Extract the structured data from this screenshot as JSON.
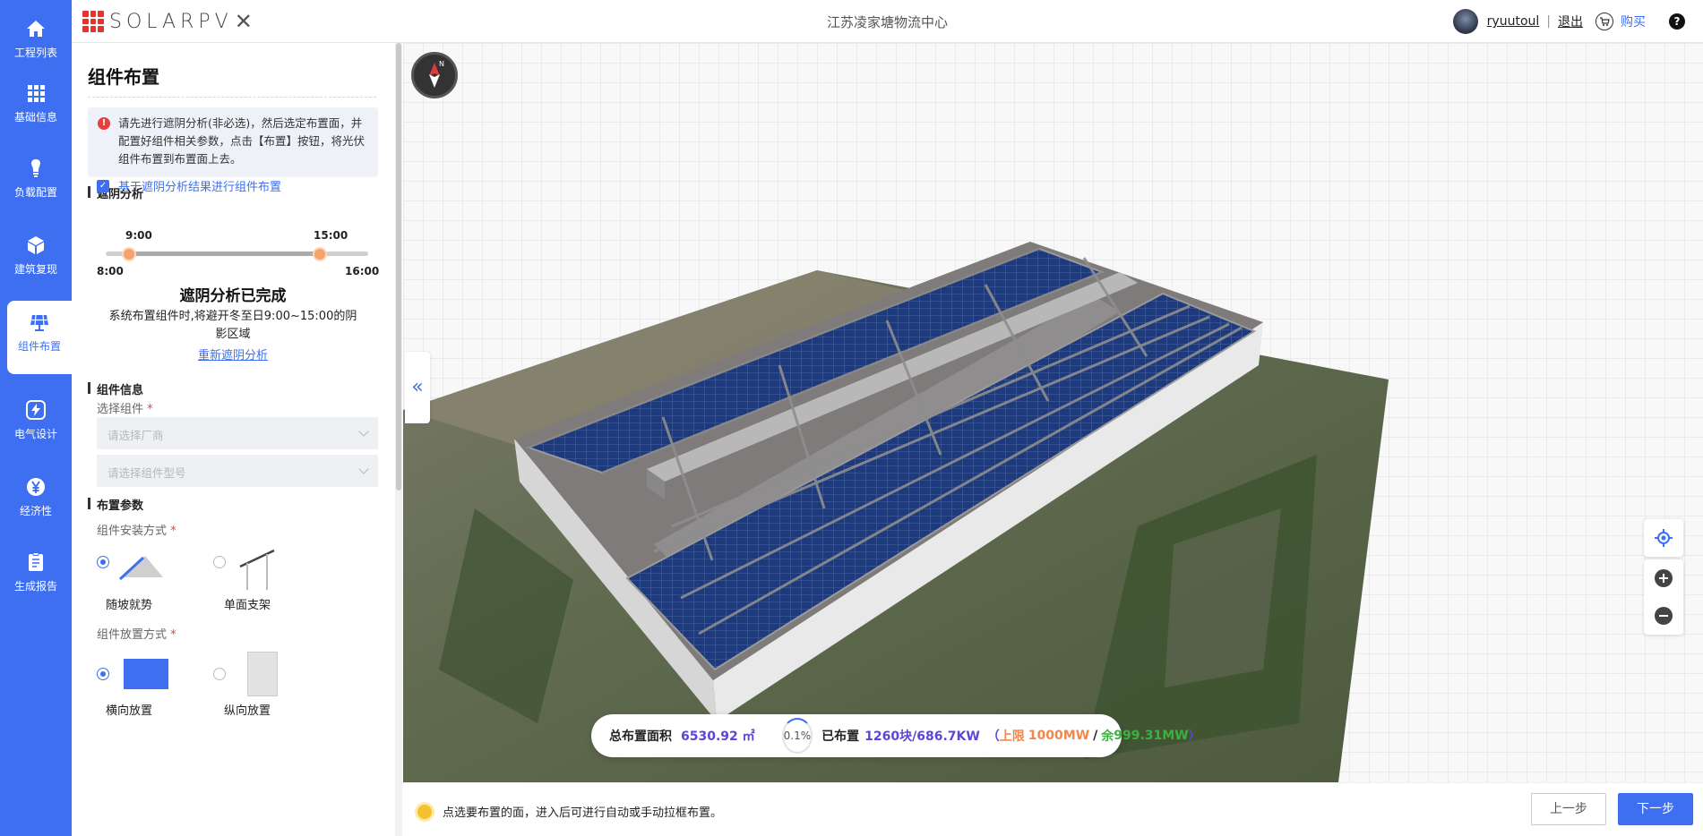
{
  "nav": {
    "items": [
      {
        "label": "工程列表",
        "icon": "home-icon"
      },
      {
        "label": "基础信息",
        "icon": "grid-icon"
      },
      {
        "label": "负载配置",
        "icon": "bulb-icon"
      },
      {
        "label": "建筑复现",
        "icon": "cube-icon"
      },
      {
        "label": "组件布置",
        "icon": "solar-panel-icon",
        "active": true
      },
      {
        "label": "电气设计",
        "icon": "lightning-icon"
      },
      {
        "label": "经济性",
        "icon": "yen-icon"
      },
      {
        "label": "生成报告",
        "icon": "report-icon"
      }
    ],
    "accent": "#3d6ff0"
  },
  "header": {
    "logo_text": "SOLARPV",
    "project_title": "江苏凌家塘物流中心",
    "user_name": "ryuutoul",
    "separator": "|",
    "logout": "退出",
    "buy": "购买",
    "help": "?"
  },
  "panel": {
    "title": "组件布置",
    "notice": "请先进行遮阴分析(非必选)，然后选定布置面，并配置好组件相关参数，点击【布置】按钮，将光伏组件布置到布置面上去。",
    "shade": {
      "heading": "遮阴分析",
      "checkbox_label": "基于遮阴分析结果进行组件布置",
      "checked": true,
      "range_start": "9:00",
      "range_end": "15:00",
      "min": "8:00",
      "max": "16:00",
      "done_title": "遮阴分析已完成",
      "done_desc": "系统布置组件时,将避开冬至日9:00~15:00的阴影区域",
      "reanalyze": "重新遮阴分析"
    },
    "module": {
      "heading": "组件信息",
      "select_label": "选择组件",
      "required_mark": "*",
      "maker_placeholder": "请选择厂商",
      "model_placeholder": "请选择组件型号"
    },
    "layout": {
      "heading": "布置参数",
      "install_label": "组件安装方式",
      "install_options": [
        {
          "label": "随坡就势",
          "selected": true
        },
        {
          "label": "单面支架",
          "selected": false
        }
      ],
      "placement_label": "组件放置方式",
      "placement_options": [
        {
          "label": "横向放置",
          "selected": true
        },
        {
          "label": "纵向放置",
          "selected": false
        }
      ]
    }
  },
  "stats": {
    "area_label": "总布置面积",
    "area_value": "6530.92 ㎡",
    "percent": "0.1%",
    "placed_label": "已布置",
    "placed_value": "1260块/686.7KW",
    "limit_prefix": "上限",
    "limit_value": "1000MW",
    "slash": "/",
    "rest_prefix": "余",
    "rest_value": "999.31MW",
    "paren_open": "（",
    "paren_close": "）"
  },
  "footer": {
    "tip": "点选要布置的面，进入后可进行自动或手动拉框布置。",
    "prev": "上一步",
    "next": "下一步"
  }
}
